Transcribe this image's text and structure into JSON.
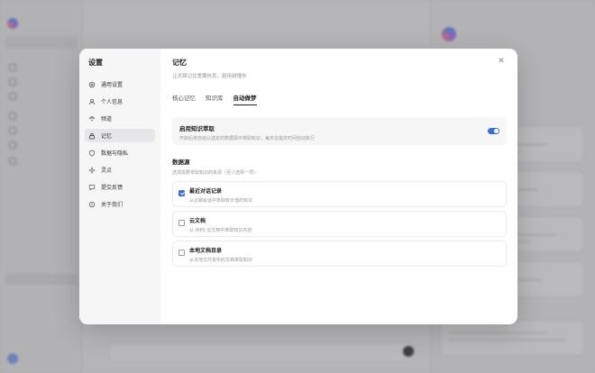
{
  "modal": {
    "title": "设置",
    "nav": [
      {
        "label": "通用设置",
        "icon": "gear-icon"
      },
      {
        "label": "个人信息",
        "icon": "user-icon"
      },
      {
        "label": "频道",
        "icon": "channel-icon"
      },
      {
        "label": "记忆",
        "icon": "lock-icon",
        "active": true
      },
      {
        "label": "数据与隐私",
        "icon": "shield-icon"
      },
      {
        "label": "灵点",
        "icon": "sparkle-icon"
      },
      {
        "label": "提交反馈",
        "icon": "feedback-icon"
      },
      {
        "label": "关于我们",
        "icon": "info-icon"
      }
    ],
    "close_icon": "close-icon"
  },
  "memory": {
    "title": "记忆",
    "description": "让灵犀记住重要信息，越用越懂你",
    "tabs": [
      {
        "label": "核心记忆",
        "active": false
      },
      {
        "label": "知识库",
        "active": false
      },
      {
        "label": "自动做梦",
        "active": true
      }
    ],
    "knowledge": {
      "title": "启用知识萃取",
      "description": "开启后将自动从选定的数据源中萃取知识，每天在指定时间自动执行",
      "enabled": true
    },
    "datasource": {
      "title": "数据源",
      "description": "选择需要萃取知识的来源（至少选择一项）",
      "items": [
        {
          "name": "最近对话记录",
          "desc": "从近期会话中萃取有价值的知识",
          "checked": true
        },
        {
          "name": "云文档",
          "desc": "从 WPS 云文档中萃取知识内容",
          "checked": false
        },
        {
          "name": "本地文档目录",
          "desc": "从本地文件夹中的文档萃取知识",
          "checked": false
        }
      ]
    }
  },
  "colors": {
    "accent": "#3b6fdc"
  }
}
